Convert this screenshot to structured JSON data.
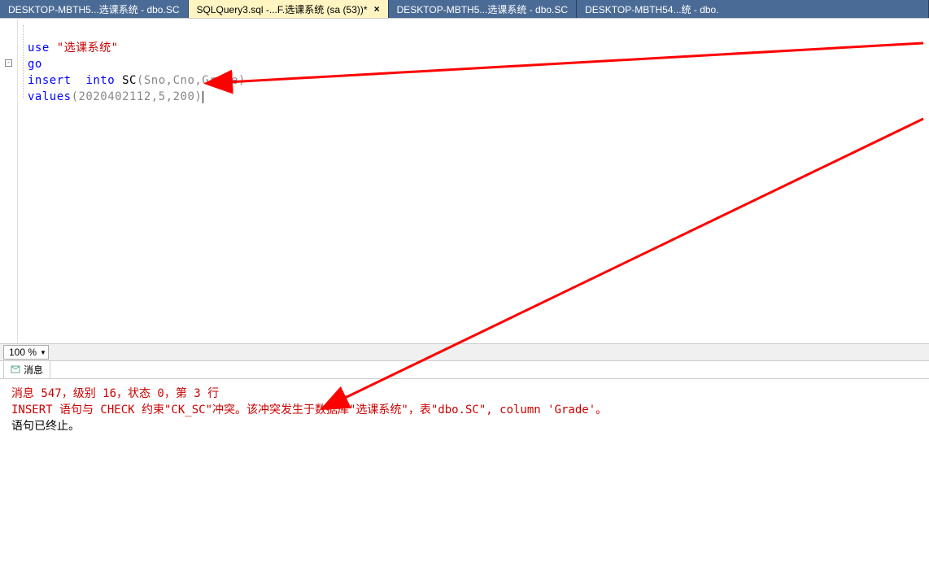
{
  "tabs": [
    {
      "label": "DESKTOP-MBTH5...选课系统 - dbo.SC",
      "active": false
    },
    {
      "label": "SQLQuery3.sql -...F.选课系统 (sa (53))*",
      "active": true
    },
    {
      "label": "DESKTOP-MBTH5...选课系统 - dbo.SC",
      "active": false
    },
    {
      "label": "DESKTOP-MBTH54...统 - dbo.",
      "active": false
    }
  ],
  "close_glyph": "×",
  "code": {
    "l1": {
      "kw": "use",
      "str": "\"选课系统\""
    },
    "l2": {
      "kw": "go"
    },
    "l3": {
      "kw1": "insert",
      "kw2": "into",
      "fn": "SC",
      "args": "(Sno,Cno,Grade)"
    },
    "l4": {
      "kw": "values",
      "args": "(2020402112,5,200)"
    }
  },
  "zoom": "100 %",
  "messages_tab": "消息",
  "messages": {
    "line1": "消息 547，级别 16，状态 0，第 3 行",
    "line2": "INSERT 语句与 CHECK 约束\"CK_SC\"冲突。该冲突发生于数据库\"选课系统\"，表\"dbo.SC\", column 'Grade'。",
    "line3": "语句已终止。"
  },
  "fold_glyph": "⊟"
}
